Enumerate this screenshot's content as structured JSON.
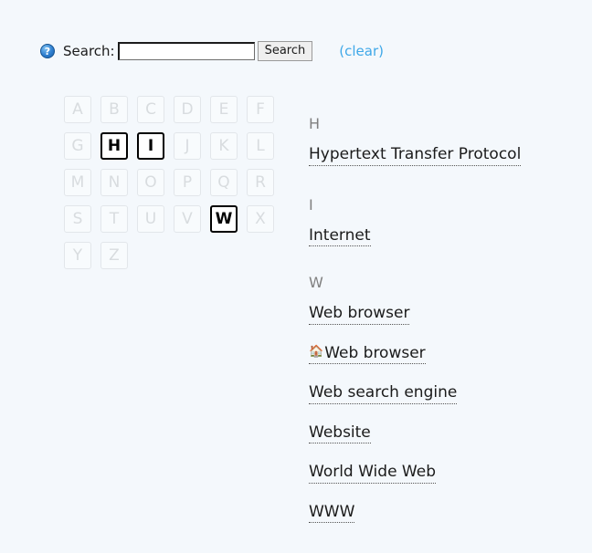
{
  "page": {
    "background_color": "#f4f8fc",
    "text_color": "#1b1b1b"
  },
  "search": {
    "help_icon": "help-circle-icon",
    "label": "Search:",
    "value": "",
    "placeholder": "",
    "button_label": "Search",
    "clear_label": "(clear)",
    "clear_color": "#3fa8e8"
  },
  "alphabet": {
    "letters": [
      {
        "letter": "A",
        "active": false
      },
      {
        "letter": "B",
        "active": false
      },
      {
        "letter": "C",
        "active": false
      },
      {
        "letter": "D",
        "active": false
      },
      {
        "letter": "E",
        "active": false
      },
      {
        "letter": "F",
        "active": false
      },
      {
        "letter": "G",
        "active": false
      },
      {
        "letter": "H",
        "active": true
      },
      {
        "letter": "I",
        "active": true
      },
      {
        "letter": "J",
        "active": false
      },
      {
        "letter": "K",
        "active": false
      },
      {
        "letter": "L",
        "active": false
      },
      {
        "letter": "M",
        "active": false
      },
      {
        "letter": "N",
        "active": false
      },
      {
        "letter": "O",
        "active": false
      },
      {
        "letter": "P",
        "active": false
      },
      {
        "letter": "Q",
        "active": false
      },
      {
        "letter": "R",
        "active": false
      },
      {
        "letter": "S",
        "active": false
      },
      {
        "letter": "T",
        "active": false
      },
      {
        "letter": "U",
        "active": false
      },
      {
        "letter": "V",
        "active": false
      },
      {
        "letter": "W",
        "active": true
      },
      {
        "letter": "X",
        "active": false
      },
      {
        "letter": "Y",
        "active": false
      },
      {
        "letter": "Z",
        "active": false
      }
    ],
    "active_color": "#000000",
    "disabled_color": "#d8dcdf"
  },
  "results": {
    "heading_color": "#808080",
    "groups": [
      {
        "heading": "H",
        "entries": [
          {
            "label": "Hypertext Transfer Protocol",
            "icon": null
          }
        ]
      },
      {
        "heading": "I",
        "entries": [
          {
            "label": "Internet",
            "icon": null
          }
        ]
      },
      {
        "heading": "W",
        "entries": [
          {
            "label": "Web browser",
            "icon": null
          },
          {
            "label": "Web browser",
            "icon": "home-icon"
          },
          {
            "label": "Web search engine",
            "icon": null
          },
          {
            "label": "Website",
            "icon": null
          },
          {
            "label": "World Wide Web",
            "icon": null
          },
          {
            "label": "WWW",
            "icon": null
          }
        ]
      }
    ]
  }
}
